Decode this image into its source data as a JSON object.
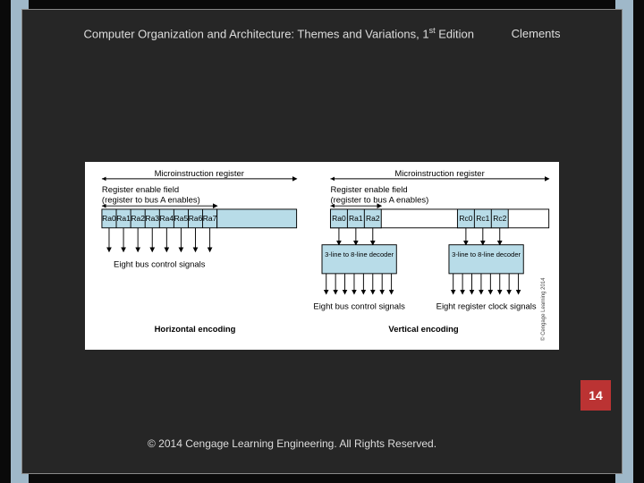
{
  "header": {
    "title_pre": "Computer Organization and Architecture: Themes and Variations, 1",
    "title_sup": "st",
    "title_post": " Edition",
    "author": "Clements"
  },
  "page_number": "14",
  "footer": "© 2014 Cengage Learning Engineering. All Rights Reserved.",
  "figure_side_credit": "© Cengage Learning 2014",
  "diagram": {
    "left": {
      "top_label": "Microinstruction register",
      "field_label_line1": "Register enable field",
      "field_label_line2": "(register to bus A enables)",
      "bits": [
        "Ra0",
        "Ra1",
        "Ra2",
        "Ra3",
        "Ra4",
        "Ra5",
        "Ra6",
        "Ra7"
      ],
      "output_label": "Eight bus control signals",
      "encoding_label": "Horizontal encoding"
    },
    "right": {
      "top_label": "Microinstruction register",
      "field_label_line1": "Register enable field",
      "field_label_line2": "(register to bus A enables)",
      "groupA_bits": [
        "Ra0",
        "Ra1",
        "Ra2"
      ],
      "groupC_bits": [
        "Rc0",
        "Rc1",
        "Rc2"
      ],
      "decoderA": "3-line to 8-line decoder",
      "decoderC": "3-line to 8-line decoder",
      "outputA_label": "Eight bus control signals",
      "outputC_label": "Eight register clock signals",
      "encoding_label": "Vertical encoding"
    }
  }
}
